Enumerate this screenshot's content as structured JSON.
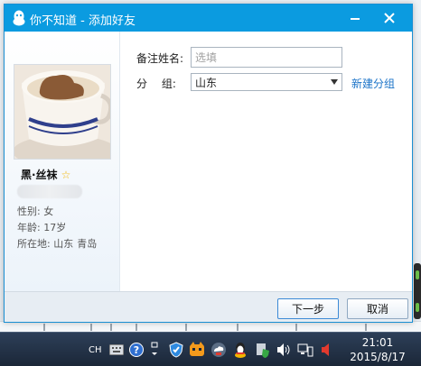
{
  "window": {
    "title": "你不知道 - 添加好友",
    "minimize_icon": "minimize-icon",
    "close_icon": "close-icon"
  },
  "profile": {
    "nickname": "黑·丝袜",
    "star_icon": "star-icon",
    "gender": "性别: 女",
    "age": "年龄: 17岁",
    "location_label": "所在地: 山东",
    "location_city": "青岛"
  },
  "form": {
    "remark_label": "备注姓名:",
    "remark_placeholder": "选填",
    "remark_value": "",
    "group_label": "分　 组:",
    "group_selected": "山东",
    "new_group_link": "新建分组"
  },
  "footer": {
    "next_label": "下一步",
    "cancel_label": "取消"
  },
  "taskbar": {
    "language": "CH",
    "time": "21:01",
    "date": "2015/8/17"
  },
  "colors": {
    "titlebar": "#0b9be0",
    "link": "#1a73c8",
    "taskbar": "#1b2738"
  }
}
